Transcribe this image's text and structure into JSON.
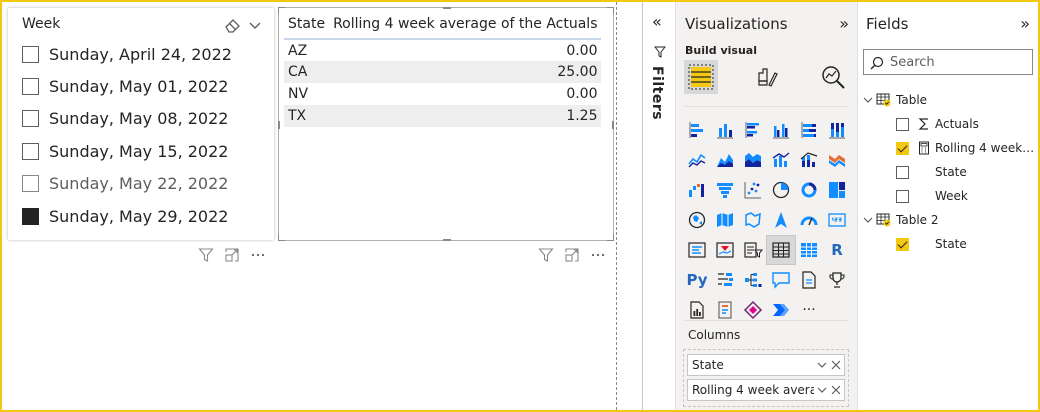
{
  "slicer": {
    "title": "Week",
    "items": [
      {
        "label": "Sunday, April 24, 2022",
        "checked": false,
        "dim": false
      },
      {
        "label": "Sunday, May 01, 2022",
        "checked": false,
        "dim": false
      },
      {
        "label": "Sunday, May 08, 2022",
        "checked": false,
        "dim": false
      },
      {
        "label": "Sunday, May 15, 2022",
        "checked": false,
        "dim": false
      },
      {
        "label": "Sunday, May 22, 2022",
        "checked": false,
        "dim": true
      },
      {
        "label": "Sunday, May 29, 2022",
        "checked": true,
        "dim": false
      }
    ]
  },
  "table_visual": {
    "headers": [
      "State",
      "Rolling 4 week average of the Actuals"
    ],
    "rows": [
      {
        "state": "AZ",
        "value": "0.00"
      },
      {
        "state": "CA",
        "value": "25.00"
      },
      {
        "state": "NV",
        "value": "0.00"
      },
      {
        "state": "TX",
        "value": "1.25"
      }
    ]
  },
  "filters_pane": {
    "label": "Filters",
    "collapse_glyph": "«"
  },
  "visualizations": {
    "title": "Visualizations",
    "collapse_glyph": "»",
    "build_label": "Build visual",
    "columns_label": "Columns",
    "r_visual_glyph": "R",
    "python_visual_glyph": "Py",
    "more_glyph": "···",
    "column_fields": [
      "State",
      "Rolling 4 week averag..."
    ]
  },
  "fields": {
    "title": "Fields",
    "collapse_glyph": "»",
    "search_placeholder": "Search",
    "tables": [
      {
        "name": "Table",
        "fields": [
          {
            "name": "Actuals",
            "checked": false,
            "icon": "sigma-icon"
          },
          {
            "name": "Rolling 4 week a...",
            "checked": true,
            "icon": "calculator-icon"
          },
          {
            "name": "State",
            "checked": false,
            "icon": ""
          },
          {
            "name": "Week",
            "checked": false,
            "icon": ""
          }
        ]
      },
      {
        "name": "Table 2",
        "fields": [
          {
            "name": "State",
            "checked": true,
            "icon": ""
          }
        ]
      }
    ]
  },
  "colors": {
    "accent": "#f2c811",
    "table_band": "#eeeeee",
    "header_rule": "#c8d6ea",
    "pane_bg": "#f3f2f1",
    "selection_box": "#d8d8d8"
  }
}
